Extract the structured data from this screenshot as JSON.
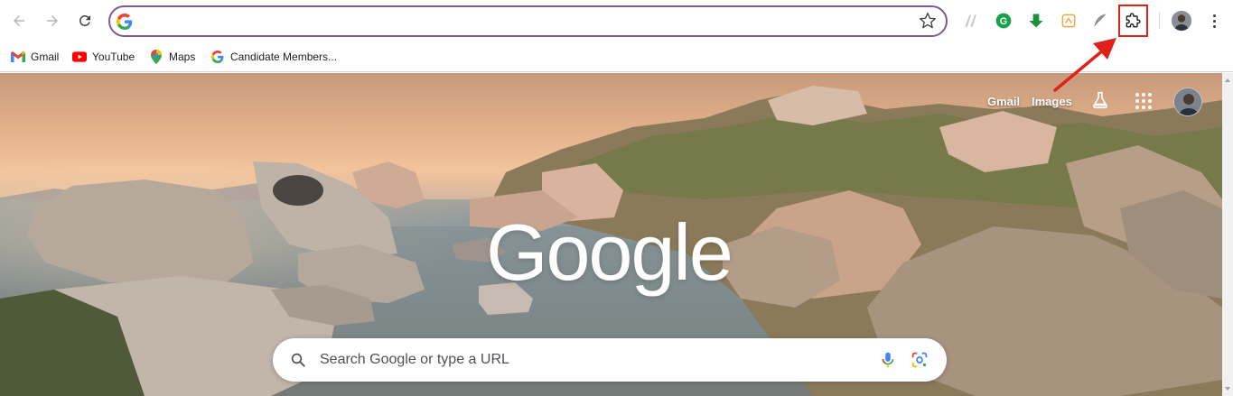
{
  "toolbar": {
    "omnibox_value": "",
    "extensions": [
      "ai-extension-icon",
      "grammarly-icon",
      "download-arrow-icon",
      "reader-extension-icon",
      "feather-icon",
      "puzzle-icon"
    ]
  },
  "bookmarks": [
    {
      "label": "Gmail",
      "icon": "gmail-icon"
    },
    {
      "label": "YouTube",
      "icon": "youtube-icon"
    },
    {
      "label": "Maps",
      "icon": "maps-icon"
    },
    {
      "label": "Candidate Members...",
      "icon": "google-g-icon"
    }
  ],
  "ntp": {
    "links": {
      "gmail": "Gmail",
      "images": "Images"
    },
    "logo": "Google",
    "search_placeholder": "Search Google or type a URL"
  },
  "colors": {
    "omnibox_border": "#7a5b8f",
    "highlight_red": "#e0201b",
    "google_blue": "#4285f4",
    "google_red": "#ea4335",
    "google_yellow": "#fbbc05",
    "google_green": "#34a853"
  }
}
